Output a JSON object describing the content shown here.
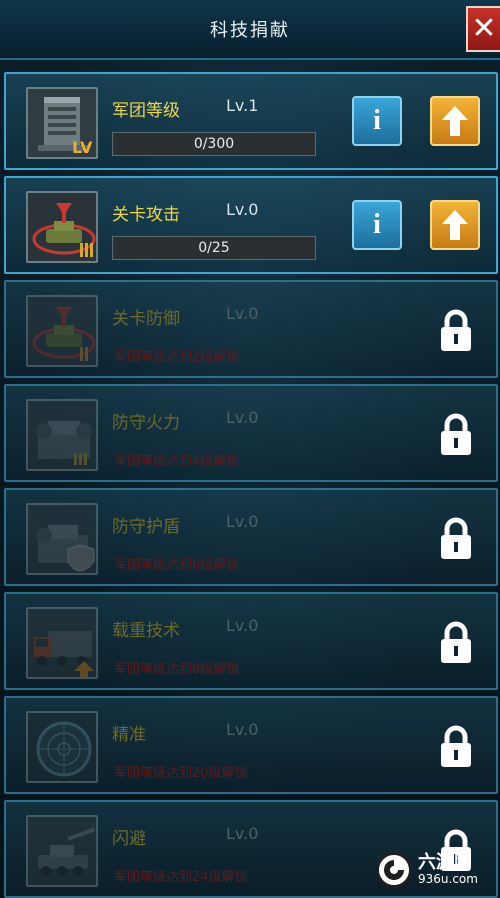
{
  "header": {
    "title": "科技捐献"
  },
  "close_icon": "close-icon",
  "items": [
    {
      "name": "军团等级",
      "level": "Lv.1",
      "progress": "0/300",
      "status": "unlocked",
      "icon": "building-lv-icon"
    },
    {
      "name": "关卡攻击",
      "level": "Lv.0",
      "progress": "0/25",
      "status": "unlocked",
      "icon": "tank-attack-icon"
    },
    {
      "name": "关卡防御",
      "level": "Lv.0",
      "requirement": "军团等级达到2级解锁",
      "status": "locked",
      "icon": "tank-defense-icon"
    },
    {
      "name": "防守火力",
      "level": "Lv.0",
      "requirement": "军团等级达到4级解锁",
      "status": "locked",
      "icon": "fortress-firepower-icon"
    },
    {
      "name": "防守护盾",
      "level": "Lv.0",
      "requirement": "军团等级达到6级解锁",
      "status": "locked",
      "icon": "fortress-shield-icon"
    },
    {
      "name": "载重技术",
      "level": "Lv.0",
      "requirement": "军团等级达到8级解锁",
      "status": "locked",
      "icon": "truck-cargo-icon"
    },
    {
      "name": "精准",
      "level": "Lv.0",
      "requirement": "军团等级达到20级解锁",
      "status": "locked",
      "icon": "radar-target-icon"
    },
    {
      "name": "闪避",
      "level": "Lv.0",
      "requirement": "军团等级达到24级解锁",
      "status": "locked",
      "icon": "artillery-dodge-icon"
    }
  ],
  "buttons": {
    "info_label": "i"
  },
  "colors": {
    "accent_blue": "#3ea6cf",
    "upgrade_orange": "#e49a22",
    "close_red": "#c8312a",
    "name_yellow": "#f0d84a",
    "locked_red": "#5c1d1d"
  },
  "watermark": {
    "main": "六游网",
    "sub": "936u.com"
  }
}
